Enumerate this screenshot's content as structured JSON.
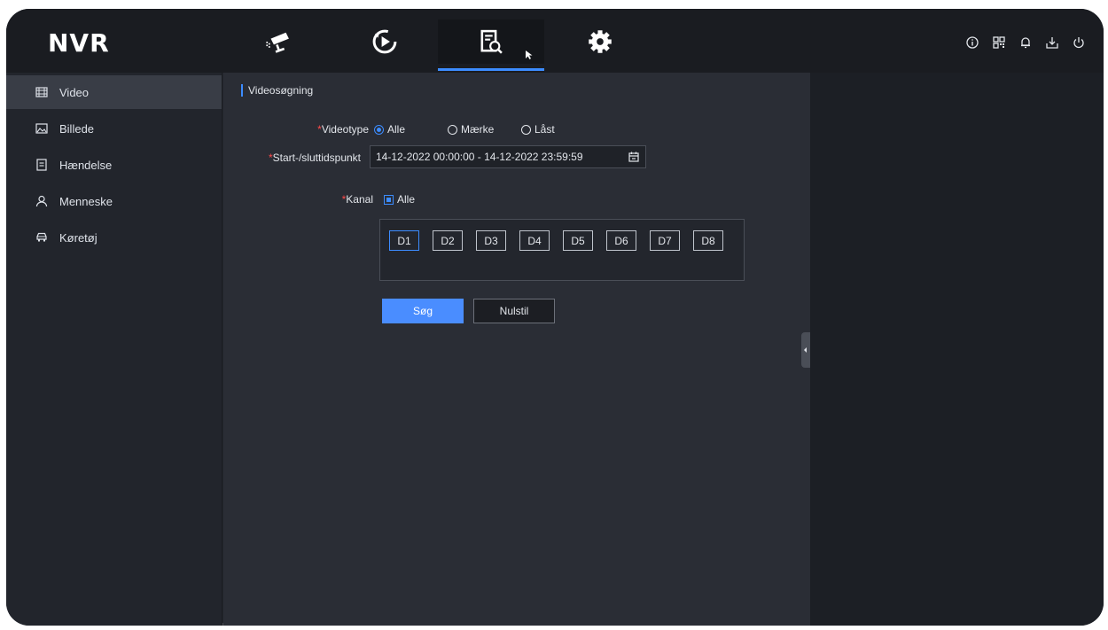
{
  "app": {
    "title": "NVR"
  },
  "colors": {
    "accent": "#3c8cff",
    "required": "#ff4b4b",
    "primary_button": "#4a8dff"
  },
  "topnav": {
    "items": [
      {
        "icon": "camera-live-view-icon"
      },
      {
        "icon": "playback-icon"
      },
      {
        "icon": "search-icon",
        "active": true
      },
      {
        "icon": "gear-icon"
      }
    ],
    "system_icons": [
      "info-icon",
      "qr-code-icon",
      "bell-icon",
      "download-icon",
      "power-icon"
    ]
  },
  "sidebar": {
    "items": [
      {
        "label": "Video",
        "icon": "video-icon",
        "active": true
      },
      {
        "label": "Billede",
        "icon": "image-icon"
      },
      {
        "label": "Hændelse",
        "icon": "document-icon"
      },
      {
        "label": "Menneske",
        "icon": "person-icon"
      },
      {
        "label": "Køretøj",
        "icon": "car-icon"
      }
    ]
  },
  "main": {
    "section_title": "Videosøgning",
    "videotype": {
      "label": "Videotype",
      "options": [
        "Alle",
        "Mærke",
        "Låst"
      ],
      "selected": "Alle"
    },
    "time": {
      "label": "Start-/sluttidspunkt",
      "value": "14-12-2022 00:00:00 - 14-12-2022 23:59:59"
    },
    "channel": {
      "label": "Kanal",
      "all_label": "Alle",
      "channels": [
        "D1",
        "D2",
        "D3",
        "D4",
        "D5",
        "D6",
        "D7",
        "D8"
      ],
      "active_channel": "D1"
    },
    "buttons": {
      "search": "Søg",
      "reset": "Nulstil"
    }
  }
}
